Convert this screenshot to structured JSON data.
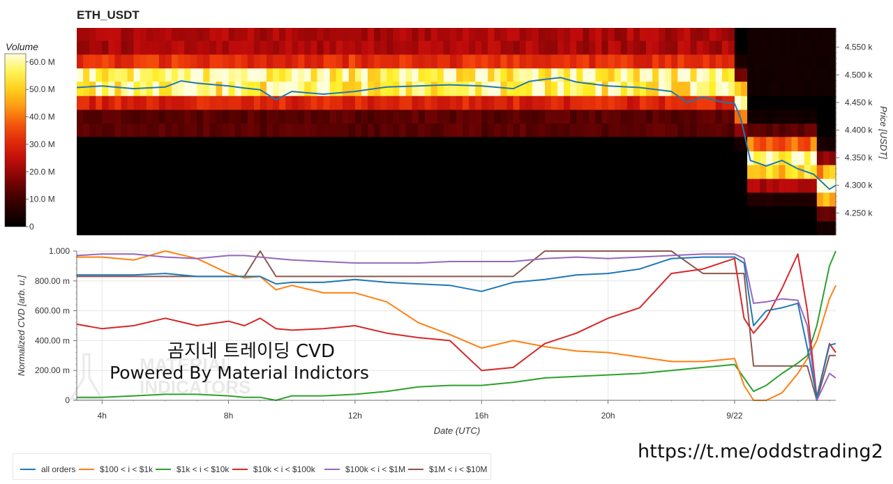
{
  "title": "ETH_USDT",
  "footer_link": "https://t.me/oddstrading2",
  "watermark": {
    "line1": "곰지네 트레이딩 CVD",
    "line2": "Powered By Material Indictors",
    "logo_text": [
      "MATERIAL",
      "INDICATORS"
    ]
  },
  "colors": {
    "all_orders": "#1f77b4",
    "s100_1k": "#ff7f0e",
    "s1k_10k": "#2ca02c",
    "s10k_100k": "#d62728",
    "s100k_1M": "#9467bd",
    "s1M_10M": "#8c564b"
  },
  "chart_data": [
    {
      "type": "heatmap",
      "title": "ETH_USDT",
      "ylabel": "Price [USDT]",
      "y_ticks": [
        "4.250 k",
        "4.300 k",
        "4.350 k",
        "4.400 k",
        "4.450 k",
        "4.500 k",
        "4.550 k"
      ],
      "y_tick_values": [
        4250,
        4300,
        4350,
        4400,
        4450,
        4500,
        4550
      ],
      "ylim": [
        4210,
        4585
      ],
      "colorbar": {
        "label": "Volume",
        "ticks": [
          "0",
          "10.0 M",
          "20.0 M",
          "30.0 M",
          "40.0 M",
          "50.0 M",
          "60.0 M"
        ],
        "tick_values": [
          0,
          10,
          20,
          30,
          40,
          50,
          60
        ],
        "range": [
          0,
          63
        ]
      },
      "price_line": {
        "x": [
          3.2,
          4,
          5,
          6,
          6.5,
          7,
          8,
          8.5,
          9,
          9.5,
          10,
          11,
          12,
          13,
          14,
          15,
          16,
          17,
          17.5,
          18,
          18.5,
          19,
          20,
          21,
          22,
          22.5,
          23,
          23.5,
          24,
          24.2,
          24.5,
          25,
          25.5,
          26,
          26.5,
          27,
          27.2
        ],
        "y": [
          4477,
          4480,
          4475,
          4478,
          4489,
          4485,
          4480,
          4476,
          4473,
          4455,
          4470,
          4465,
          4470,
          4478,
          4480,
          4482,
          4480,
          4475,
          4488,
          4492,
          4495,
          4487,
          4480,
          4477,
          4470,
          4450,
          4460,
          4452,
          4448,
          4420,
          4345,
          4335,
          4345,
          4330,
          4320,
          4293,
          4300
        ]
      }
    },
    {
      "type": "line",
      "xlabel": "Date (UTC)",
      "ylabel": "Normalized CVD [arb. u.]",
      "x_ticks": [
        "4h",
        "8h",
        "12h",
        "16h",
        "20h",
        "9/22"
      ],
      "x_tick_values": [
        4,
        8,
        12,
        16,
        20,
        24
      ],
      "xlim": [
        3.2,
        27.2
      ],
      "y_ticks": [
        "0",
        "200.00 m",
        "400.00 m",
        "600.00 m",
        "800.00 m",
        "1.000"
      ],
      "y_tick_values": [
        0,
        0.2,
        0.4,
        0.6,
        0.8,
        1.0
      ],
      "ylim": [
        0,
        1.0
      ],
      "x": [
        3.2,
        4,
        5,
        6,
        7,
        8,
        8.5,
        9,
        9.5,
        10,
        11,
        12,
        13,
        14,
        15,
        16,
        17,
        18,
        19,
        20,
        21,
        22,
        23,
        24,
        24.3,
        24.6,
        25,
        25.5,
        26,
        26.3,
        26.6,
        27,
        27.2
      ],
      "series": [
        {
          "name": "all orders",
          "values": [
            0.84,
            0.84,
            0.84,
            0.85,
            0.83,
            0.83,
            0.83,
            0.83,
            0.78,
            0.79,
            0.79,
            0.81,
            0.79,
            0.78,
            0.77,
            0.73,
            0.79,
            0.81,
            0.84,
            0.85,
            0.88,
            0.95,
            0.96,
            0.96,
            0.92,
            0.5,
            0.6,
            0.62,
            0.65,
            0.35,
            0.02,
            0.37,
            0.38
          ]
        },
        {
          "name": "$100 < i < $1k",
          "values": [
            0.96,
            0.96,
            0.94,
            1.0,
            0.95,
            0.85,
            0.82,
            0.83,
            0.74,
            0.77,
            0.72,
            0.72,
            0.66,
            0.52,
            0.44,
            0.35,
            0.4,
            0.36,
            0.33,
            0.32,
            0.29,
            0.26,
            0.26,
            0.28,
            0.1,
            0.0,
            0.0,
            0.05,
            0.18,
            0.28,
            0.4,
            0.68,
            0.77
          ]
        },
        {
          "name": "$1k < i < $10k",
          "values": [
            0.02,
            0.02,
            0.03,
            0.04,
            0.04,
            0.03,
            0.02,
            0.02,
            0.0,
            0.03,
            0.03,
            0.04,
            0.06,
            0.09,
            0.1,
            0.1,
            0.12,
            0.15,
            0.16,
            0.17,
            0.18,
            0.2,
            0.22,
            0.24,
            0.15,
            0.06,
            0.1,
            0.18,
            0.25,
            0.3,
            0.5,
            0.9,
            1.0
          ]
        },
        {
          "name": "$10k < i < $100k",
          "values": [
            0.51,
            0.48,
            0.5,
            0.55,
            0.5,
            0.53,
            0.5,
            0.55,
            0.48,
            0.47,
            0.48,
            0.5,
            0.45,
            0.42,
            0.4,
            0.2,
            0.22,
            0.38,
            0.45,
            0.55,
            0.62,
            0.85,
            0.88,
            0.95,
            0.55,
            0.45,
            0.55,
            0.75,
            0.98,
            0.6,
            0.02,
            0.38,
            0.32
          ]
        },
        {
          "name": "$100k < i < $1M",
          "values": [
            0.97,
            0.98,
            0.98,
            0.96,
            0.95,
            0.97,
            0.97,
            0.96,
            0.95,
            0.94,
            0.93,
            0.92,
            0.92,
            0.92,
            0.93,
            0.93,
            0.93,
            0.95,
            0.96,
            0.95,
            0.96,
            0.97,
            0.98,
            0.98,
            0.95,
            0.65,
            0.66,
            0.68,
            0.67,
            0.5,
            0.0,
            0.18,
            0.15
          ]
        },
        {
          "name": "$1M < i < $10M",
          "values": [
            0.83,
            0.83,
            0.83,
            0.83,
            0.83,
            0.83,
            0.83,
            1.0,
            0.83,
            0.83,
            0.83,
            0.83,
            0.83,
            0.83,
            0.83,
            0.83,
            0.83,
            1.0,
            1.0,
            1.0,
            1.0,
            1.0,
            0.85,
            0.85,
            0.85,
            0.23,
            0.23,
            0.23,
            0.23,
            0.23,
            0.0,
            0.3,
            0.3
          ]
        }
      ]
    }
  ]
}
